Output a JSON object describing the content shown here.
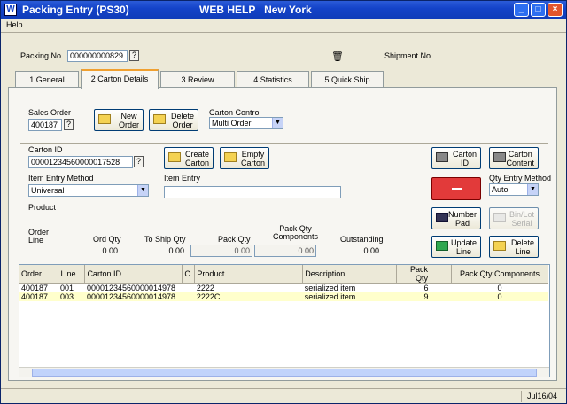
{
  "window": {
    "title": "Packing Entry (PS30)",
    "subtitle": "WEB HELP   New York",
    "app_icon": "W"
  },
  "menu": {
    "help": "Help"
  },
  "header": {
    "packing_no_label": "Packing No.",
    "packing_no_value": "000000000829",
    "shipment_no_label": "Shipment No.",
    "lookup": "?"
  },
  "tabs": [
    {
      "label": "1 General"
    },
    {
      "label": "2 Carton Details"
    },
    {
      "label": "3 Review"
    },
    {
      "label": "4 Statistics"
    },
    {
      "label": "5 Quick Ship"
    }
  ],
  "order": {
    "sales_order_label": "Sales Order",
    "sales_order_value": "400187",
    "new_order": "New\nOrder",
    "delete_order": "Delete\nOrder",
    "carton_control_label": "Carton Control",
    "carton_control_value": "Multi Order"
  },
  "carton": {
    "carton_id_label": "Carton ID",
    "carton_id_value": "00001234560000017528",
    "create_carton": "Create\nCarton",
    "empty_carton": "Empty\nCarton",
    "item_entry_method_label": "Item Entry Method",
    "item_entry_method_value": "Universal",
    "item_entry_label": "Item Entry",
    "item_entry_value": "",
    "product_label": "Product",
    "carton_id_btn": "Carton\nID",
    "carton_content_btn": "Carton\nContent",
    "qty_entry_method_label": "Qty Entry Method",
    "qty_entry_method_value": "Auto",
    "number_pad": "Number\nPad",
    "bin_lot_serial": "Bin/Lot\nSerial",
    "update_line": "Update\nLine",
    "delete_line": "Delete\nLine"
  },
  "summary": {
    "order_line_label": "Order\nLine",
    "ord_qty_label": "Ord Qty",
    "to_ship_qty_label": "To Ship Qty",
    "pack_qty_label": "Pack Qty",
    "pack_qty_components_label": "Pack Qty\nComponents",
    "outstanding_label": "Outstanding",
    "ord_qty": "0.00",
    "to_ship_qty": "0.00",
    "pack_qty": "0.00",
    "pack_qty_components": "0.00",
    "outstanding": "0.00"
  },
  "grid": {
    "columns": [
      "Order",
      "Line",
      "Carton ID",
      "C",
      "Product",
      "Description",
      "Pack Qty",
      "Pack Qty Components"
    ],
    "rows": [
      [
        "400187",
        "001",
        "00001234560000014978",
        "",
        "2222",
        "serialized item",
        "6",
        "0"
      ],
      [
        "400187",
        "003",
        "00001234560000014978",
        "",
        "2222C",
        "serialized item",
        "9",
        "0"
      ]
    ]
  },
  "status": {
    "date": "Jul16/04"
  }
}
